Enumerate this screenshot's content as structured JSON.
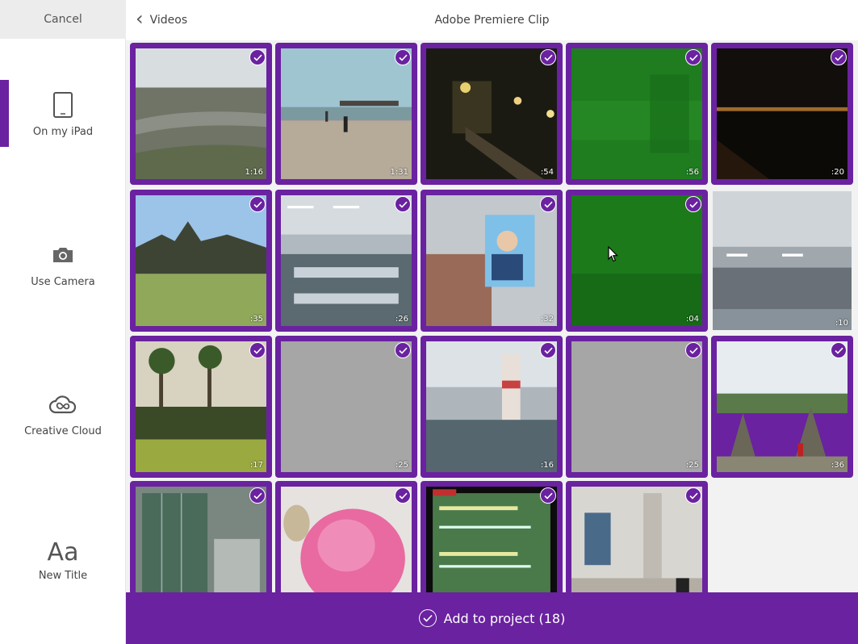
{
  "sidebar": {
    "cancel_label": "Cancel",
    "items": [
      {
        "label": "On my iPad",
        "icon": "tablet-icon",
        "active": true
      },
      {
        "label": "Use Camera",
        "icon": "camera-icon",
        "active": false
      },
      {
        "label": "Creative Cloud",
        "icon": "creative-cloud-icon",
        "active": false
      },
      {
        "label": "New Title",
        "icon": "text-title-icon",
        "glyph": "Aa",
        "active": false
      }
    ]
  },
  "header": {
    "back_label": "Videos",
    "title": "Adobe Premiere Clip"
  },
  "clips": [
    {
      "duration": "1:16",
      "selected": true,
      "scene": "aerial-landscape"
    },
    {
      "duration": "1:31",
      "selected": true,
      "scene": "beach-pier"
    },
    {
      "duration": ":54",
      "selected": true,
      "scene": "night-street"
    },
    {
      "duration": ":56",
      "selected": true,
      "scene": "green-night-vision"
    },
    {
      "duration": ":20",
      "selected": true,
      "scene": "night-city-lights"
    },
    {
      "duration": ":35",
      "selected": true,
      "scene": "temple-lawn"
    },
    {
      "duration": ":26",
      "selected": true,
      "scene": "factory-floor"
    },
    {
      "duration": ":32",
      "selected": true,
      "scene": "billboard-street"
    },
    {
      "duration": ":04",
      "selected": true,
      "scene": "green-field"
    },
    {
      "duration": ":10",
      "selected": false,
      "scene": "warehouse-hall"
    },
    {
      "duration": ":17",
      "selected": true,
      "scene": "palm-garden"
    },
    {
      "duration": ":25",
      "selected": true,
      "scene": "blank-grey"
    },
    {
      "duration": ":16",
      "selected": true,
      "scene": "factory-pillar"
    },
    {
      "duration": ":25",
      "selected": true,
      "scene": "blank-grey"
    },
    {
      "duration": ":36",
      "selected": true,
      "scene": "temple-stupas"
    },
    {
      "duration": "",
      "selected": true,
      "scene": "glass-building"
    },
    {
      "duration": "",
      "selected": true,
      "scene": "pink-rose"
    },
    {
      "duration": "",
      "selected": true,
      "scene": "tv-screen"
    },
    {
      "duration": "",
      "selected": true,
      "scene": "airport-terminal"
    }
  ],
  "footer": {
    "label": "Add to project (18)"
  },
  "colors": {
    "accent": "#6a22a0",
    "sidebar_bg": "#ffffff",
    "grid_bg": "#f2f2f2",
    "cancel_bg": "#ececec"
  }
}
